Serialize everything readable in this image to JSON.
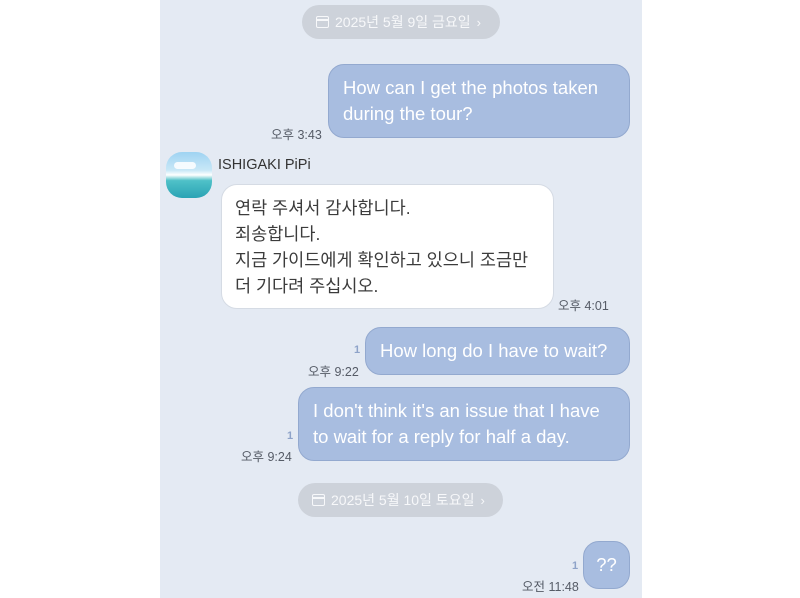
{
  "dates": [
    {
      "label": "2025년 5월 9일 금요일"
    },
    {
      "label": "2025년 5월 10일 토요일"
    }
  ],
  "sender": {
    "name": "ISHIGAKI  PiPi"
  },
  "messages": [
    {
      "direction": "out",
      "lines": [
        "How can I get the photos taken",
        "during the tour?"
      ],
      "time": "오후 3:43"
    },
    {
      "direction": "in",
      "lines": [
        "연락 주셔서 감사합니다.",
        "죄송합니다.",
        "지금 가이드에게 확인하고 있으니 조금만",
        "더 기다려 주십시오."
      ],
      "time": "오후 4:01"
    },
    {
      "direction": "out",
      "lines": [
        "How long do I have to wait?"
      ],
      "time": "오후 9:22",
      "unread": "1"
    },
    {
      "direction": "out",
      "lines": [
        "I don't think it's an issue that I have",
        "to wait for a reply for half a day."
      ],
      "time": "오후 9:24",
      "unread": "1"
    },
    {
      "direction": "out",
      "lines": [
        "??"
      ],
      "time": "오전 11:48",
      "unread": "1"
    }
  ]
}
